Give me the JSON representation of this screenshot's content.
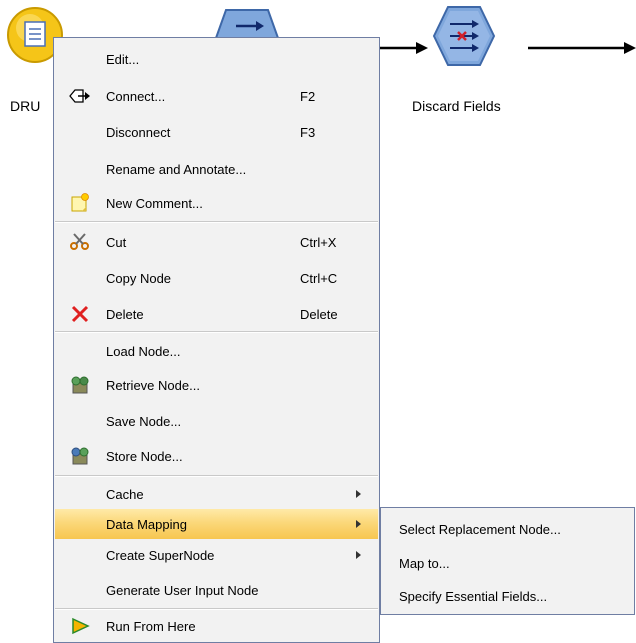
{
  "canvas": {
    "source_node_label": "DRU",
    "discard_node_label": "Discard Fields"
  },
  "menu": {
    "items": [
      {
        "label": "Edit...",
        "shortcut": "",
        "icon": "none"
      },
      {
        "label": "Connect...",
        "shortcut": "F2",
        "icon": "connect-icon"
      },
      {
        "label": "Disconnect",
        "shortcut": "F3",
        "icon": "none"
      },
      {
        "label": "Rename and Annotate...",
        "shortcut": "",
        "icon": "none"
      },
      {
        "label": "New Comment...",
        "shortcut": "",
        "icon": "comment-icon"
      },
      {
        "label": "Cut",
        "shortcut": "Ctrl+X",
        "icon": "scissors-icon"
      },
      {
        "label": "Copy Node",
        "shortcut": "Ctrl+C",
        "icon": "none"
      },
      {
        "label": "Delete",
        "shortcut": "Delete",
        "icon": "delete-icon"
      },
      {
        "label": "Load Node...",
        "shortcut": "",
        "icon": "none"
      },
      {
        "label": "Retrieve Node...",
        "shortcut": "",
        "icon": "retrieve-icon"
      },
      {
        "label": "Save Node...",
        "shortcut": "",
        "icon": "none"
      },
      {
        "label": "Store Node...",
        "shortcut": "",
        "icon": "store-icon"
      },
      {
        "label": "Cache",
        "shortcut": "",
        "icon": "none",
        "submenu": true
      },
      {
        "label": "Data Mapping",
        "shortcut": "",
        "icon": "none",
        "submenu": true,
        "highlighted": true
      },
      {
        "label": "Create SuperNode",
        "shortcut": "",
        "icon": "none",
        "submenu": true
      },
      {
        "label": "Generate User Input Node",
        "shortcut": "",
        "icon": "none"
      },
      {
        "label": "Run From Here",
        "shortcut": "",
        "icon": "run-icon"
      }
    ]
  },
  "submenu": {
    "items": [
      {
        "label": "Select Replacement Node..."
      },
      {
        "label": "Map to..."
      },
      {
        "label": "Specify Essential Fields..."
      }
    ]
  },
  "colors": {
    "highlight": "#f7c650",
    "menu_bg": "#f2f2f2",
    "menu_border": "#6f7ea3",
    "source_node": "#f5c518",
    "process_node": "#7fa7dc"
  }
}
